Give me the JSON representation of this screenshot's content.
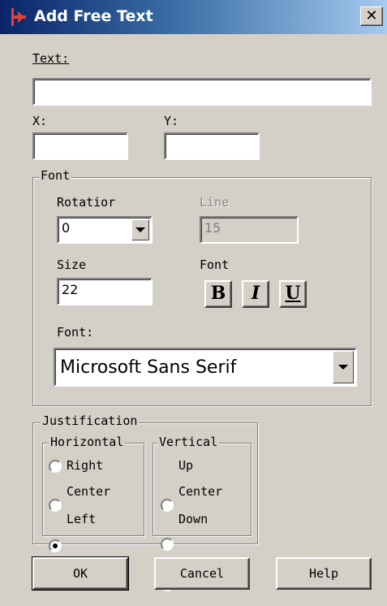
{
  "window": {
    "title": "Add Free Text"
  },
  "text": {
    "label": "Text:",
    "value": ""
  },
  "coords": {
    "x_label": "X:",
    "x_value": "",
    "y_label": "Y:",
    "y_value": ""
  },
  "font_group": {
    "legend": "Font",
    "rotation_label": "Rotatior",
    "rotation_value": "0",
    "line_label": "Line",
    "line_value": "15",
    "size_label": "Size",
    "size_value": "22",
    "style_label": "Font",
    "bold": "B",
    "italic": "I",
    "underline": "U",
    "font_label": "Font:",
    "font_value": "Microsoft Sans Serif"
  },
  "justification": {
    "legend": "Justification",
    "horizontal": {
      "legend": "Horizontal",
      "options": [
        {
          "label": "Right",
          "selected": false
        },
        {
          "label": "Center",
          "selected": false
        },
        {
          "label": "Left",
          "selected": true
        }
      ]
    },
    "vertical": {
      "legend": "Vertical",
      "options": [
        {
          "label": "Up",
          "selected": false
        },
        {
          "label": "Center",
          "selected": false
        },
        {
          "label": "Down",
          "selected": true
        }
      ]
    }
  },
  "buttons": {
    "ok": "OK",
    "cancel": "Cancel",
    "help": "Help"
  }
}
